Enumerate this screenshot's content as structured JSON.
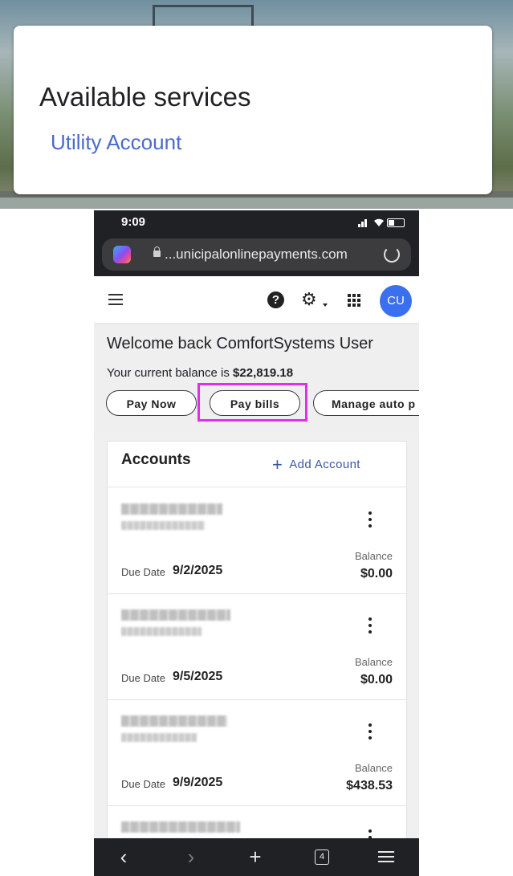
{
  "services": {
    "title": "Available services",
    "link": "Utility Account"
  },
  "status_bar": {
    "time": "9:09"
  },
  "browser": {
    "url": "...unicipalonlinepayments.com",
    "tab_count": "4"
  },
  "app_header": {
    "avatar_initials": "CU",
    "help_glyph": "?",
    "gear_glyph": "⚙"
  },
  "welcome": {
    "title": "Welcome back ComfortSystems User",
    "balance_prefix": "Your current balance is",
    "balance_amount": "$22,819.18",
    "buttons": {
      "pay_now": "Pay Now",
      "pay_bills": "Pay bills",
      "manage_auto": "Manage auto p"
    }
  },
  "accounts": {
    "title": "Accounts",
    "add_label": "Add Account",
    "add_glyph": "+",
    "due_label": "Due Date",
    "balance_label": "Balance",
    "rows": [
      {
        "due_date": "9/2/2025",
        "balance": "$0.00"
      },
      {
        "due_date": "9/5/2025",
        "balance": "$0.00"
      },
      {
        "due_date": "9/9/2025",
        "balance": "$438.53"
      }
    ]
  },
  "bottom_nav": {
    "back": "‹",
    "forward": "›",
    "new_tab": "+"
  },
  "colors": {
    "link": "#4a6cc9",
    "avatar": "#3a6ff0",
    "highlight": "#e22ee6",
    "add_account": "#3b57a8"
  },
  "icons": [
    "copilot-icon",
    "lock-icon",
    "reload-icon",
    "hamburger-icon",
    "help-icon",
    "gear-icon",
    "apps-grid-icon",
    "plus-icon",
    "kebab-icon",
    "back-icon",
    "forward-icon",
    "new-tab-icon",
    "tabs-icon",
    "menu-icon"
  ]
}
